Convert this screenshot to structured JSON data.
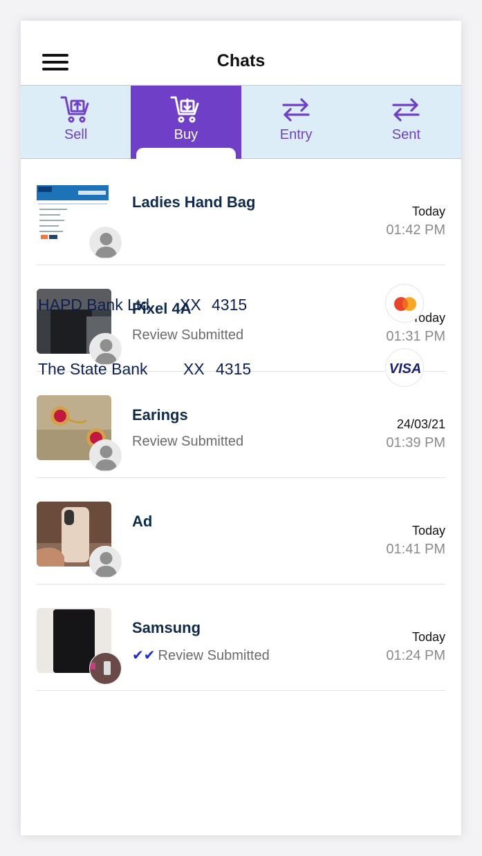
{
  "header": {
    "title": "Chats"
  },
  "tabs": [
    {
      "label": "Sell",
      "icon": "cart-upload-icon",
      "active": false
    },
    {
      "label": "Buy",
      "icon": "cart-download-icon",
      "active": true
    },
    {
      "label": "Entry",
      "icon": "swap-arrows-icon",
      "active": false
    },
    {
      "label": "Sent",
      "icon": "swap-arrows-icon",
      "active": false
    }
  ],
  "chats": [
    {
      "title": "Ladies Hand Bag",
      "subtitle": "",
      "date": "Today",
      "time": "01:42 PM"
    },
    {
      "title": "Pixel 4A",
      "subtitle": "Review Submitted",
      "date": "Today",
      "time": "01:31 PM"
    },
    {
      "title": "Earings",
      "subtitle": "Review Submitted",
      "date": "24/03/21",
      "time": "01:39 PM"
    },
    {
      "title": "Ad",
      "subtitle": "",
      "date": "Today",
      "time": "01:41 PM"
    },
    {
      "title": "Samsung",
      "subtitle": "Review Submitted",
      "ticks": "✔✔",
      "date": "Today",
      "time": "01:24 PM"
    }
  ],
  "bank_cards": [
    {
      "name": "HAPD Bank Ltd",
      "mask": "XX",
      "last4": "4315",
      "brand": "mastercard"
    },
    {
      "name": "The State Bank",
      "mask": "XX",
      "last4": "4315",
      "brand": "visa",
      "brand_text": "VISA"
    }
  ],
  "colors": {
    "accent": "#6f3fc8",
    "tab_bg": "#dcedf7",
    "title": "#0f2a4a",
    "bank_text": "#0c1f52"
  }
}
